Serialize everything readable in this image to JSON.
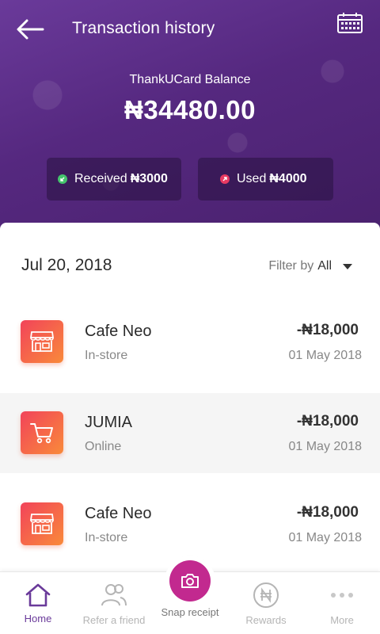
{
  "header": {
    "title": "Transaction history",
    "balance_label": "ThankUCard Balance",
    "balance_value": "₦34480.00",
    "received": {
      "label": "Received",
      "amount": "₦3000",
      "icon": "received-arrow-icon",
      "color": "#45c36d"
    },
    "used": {
      "label": "Used",
      "amount": "₦4000",
      "icon": "used-arrow-icon",
      "color": "#e83a62"
    },
    "back_icon": "back-arrow-icon",
    "calendar_icon": "calendar-icon"
  },
  "list": {
    "date": "Jul 20, 2018",
    "filter_label": "Filter by",
    "filter_value": "All",
    "transactions": [
      {
        "name": "Cafe Neo",
        "channel": "In-store",
        "amount": "-₦18,000",
        "date": "01 May 2018",
        "icon": "store-icon"
      },
      {
        "name": "JUMIA",
        "channel": "Online",
        "amount": "-₦18,000",
        "date": "01 May 2018",
        "icon": "cart-icon"
      },
      {
        "name": "Cafe Neo",
        "channel": "In-store",
        "amount": "-₦18,000",
        "date": "01 May 2018",
        "icon": "store-icon"
      }
    ]
  },
  "nav": {
    "items": [
      {
        "label": "Home",
        "icon": "home-icon",
        "active": true
      },
      {
        "label": "Refer a friend",
        "icon": "people-icon",
        "active": false
      },
      {
        "label": "Snap receipt",
        "icon": "camera-icon",
        "active": false
      },
      {
        "label": "Rewards",
        "icon": "naira-coin-icon",
        "active": false
      },
      {
        "label": "More",
        "icon": "more-dots-icon",
        "active": false
      }
    ]
  },
  "colors": {
    "header_purple": "#55287f",
    "accent_purple": "#6a3a9a",
    "snap_magenta": "#c2298f",
    "tile_gradient_start": "#f2435a",
    "tile_gradient_end": "#f98a3a"
  }
}
